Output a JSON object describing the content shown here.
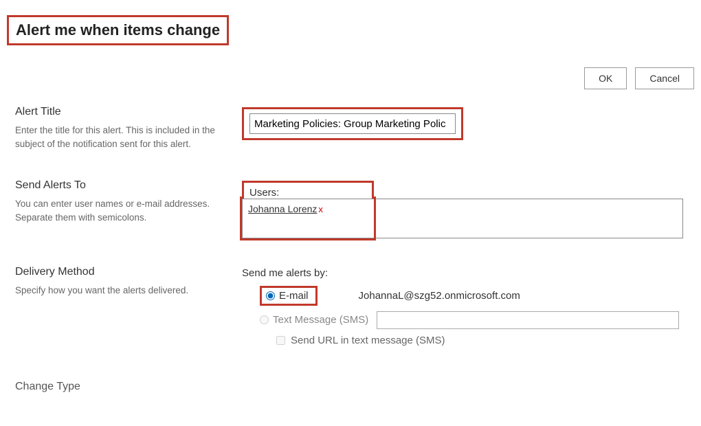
{
  "header": {
    "title": "Alert me when items change"
  },
  "buttons": {
    "ok": "OK",
    "cancel": "Cancel"
  },
  "alertTitle": {
    "heading": "Alert Title",
    "description": "Enter the title for this alert. This is included in the subject of the notification sent for this alert.",
    "value": "Marketing Policies: Group Marketing Polic"
  },
  "sendAlertsTo": {
    "heading": "Send Alerts To",
    "description": "You can enter user names or e-mail addresses. Separate them with semicolons.",
    "usersLabel": "Users:",
    "userName": "Johanna Lorenz",
    "removeGlyph": "x"
  },
  "deliveryMethod": {
    "heading": "Delivery Method",
    "description": "Specify how you want the alerts delivered.",
    "sendMeLabel": "Send me alerts by:",
    "emailLabel": "E-mail",
    "emailAddress": "JohannaL@szg52.onmicrosoft.com",
    "smsLabel": "Text Message (SMS)",
    "sendUrlLabel": "Send URL in text message (SMS)"
  },
  "changeType": {
    "heading": "Change Type"
  }
}
